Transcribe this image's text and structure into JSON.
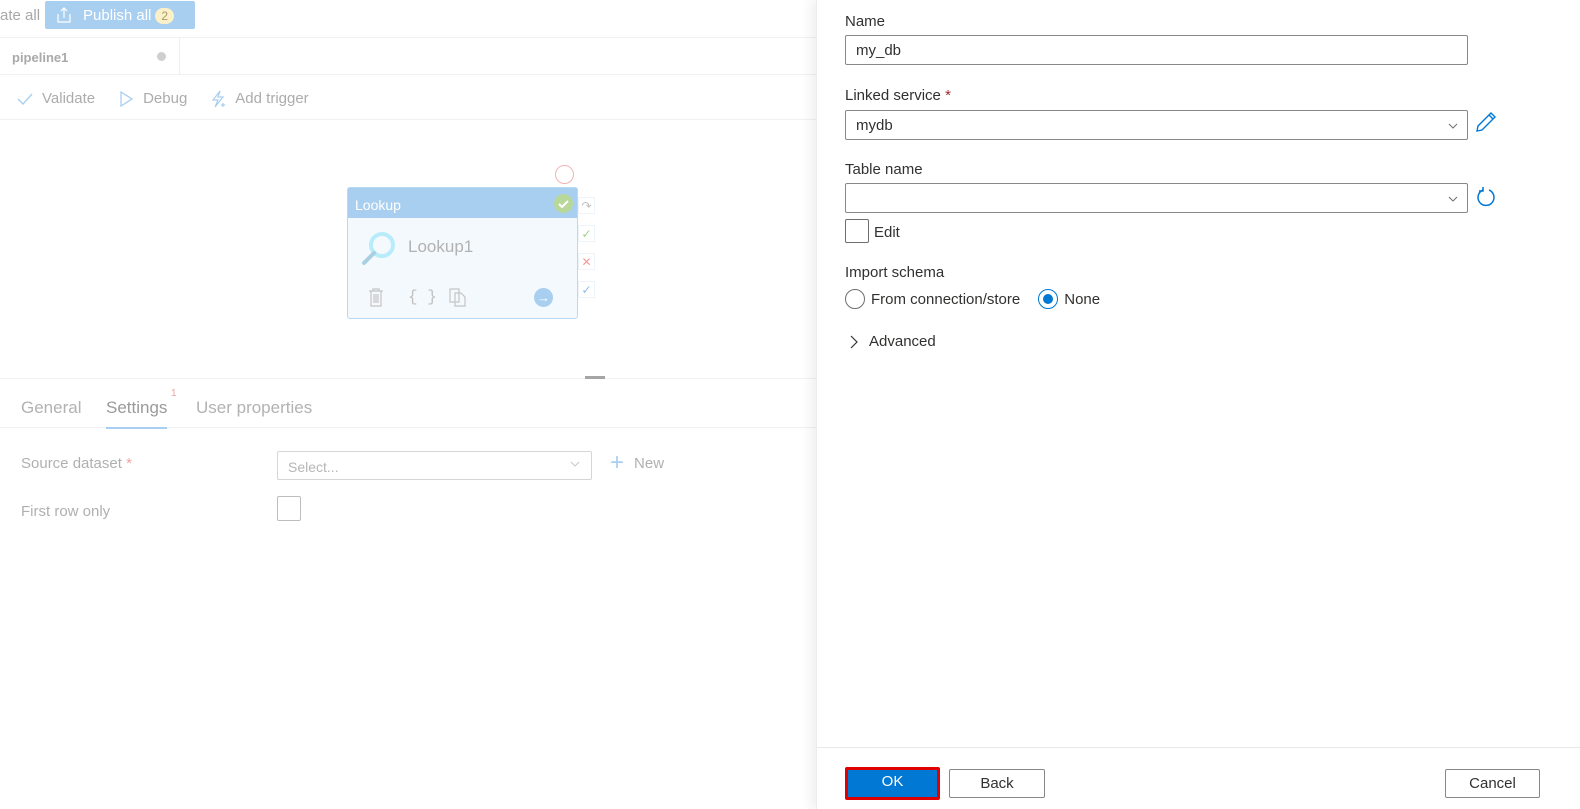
{
  "topbar": {
    "validate_all_label": "ate all",
    "publish_all_label": "Publish all",
    "publish_all_count": "2"
  },
  "pipeline_tab": {
    "label": "pipeline1"
  },
  "toolbar": {
    "validate_label": "Validate",
    "debug_label": "Debug",
    "add_trigger_label": "Add trigger"
  },
  "activity": {
    "type_label": "Lookup",
    "name": "Lookup1",
    "footer_icons": [
      "delete-icon",
      "code-icon",
      "copy-icon",
      "go-arrow-icon"
    ],
    "side_icons": [
      "skip-icon",
      "success-icon",
      "failure-icon",
      "completion-icon"
    ]
  },
  "properties": {
    "tabs": [
      {
        "label": "General"
      },
      {
        "label": "Settings",
        "badge": "1",
        "active": true
      },
      {
        "label": "User properties"
      }
    ],
    "source_dataset_label": "Source dataset",
    "required_marker": "*",
    "source_dataset_placeholder": "Select...",
    "new_label": "New",
    "first_row_only_label": "First row only",
    "first_row_only_checked": false
  },
  "panel": {
    "name_label": "Name",
    "name_value": "my_db",
    "linked_service_label": "Linked service",
    "required_marker": "*",
    "linked_service_value": "mydb",
    "table_name_label": "Table name",
    "table_name_value": "",
    "edit_label": "Edit",
    "edit_checked": false,
    "import_schema_label": "Import schema",
    "import_schema_options": [
      {
        "label": "From connection/store",
        "selected": false
      },
      {
        "label": "None",
        "selected": true
      }
    ],
    "advanced_label": "Advanced",
    "buttons": {
      "ok": "OK",
      "back": "Back",
      "cancel": "Cancel"
    }
  },
  "colors": {
    "accent": "#0078d4",
    "highlight_border": "#e00000",
    "required": "#a4262c"
  }
}
